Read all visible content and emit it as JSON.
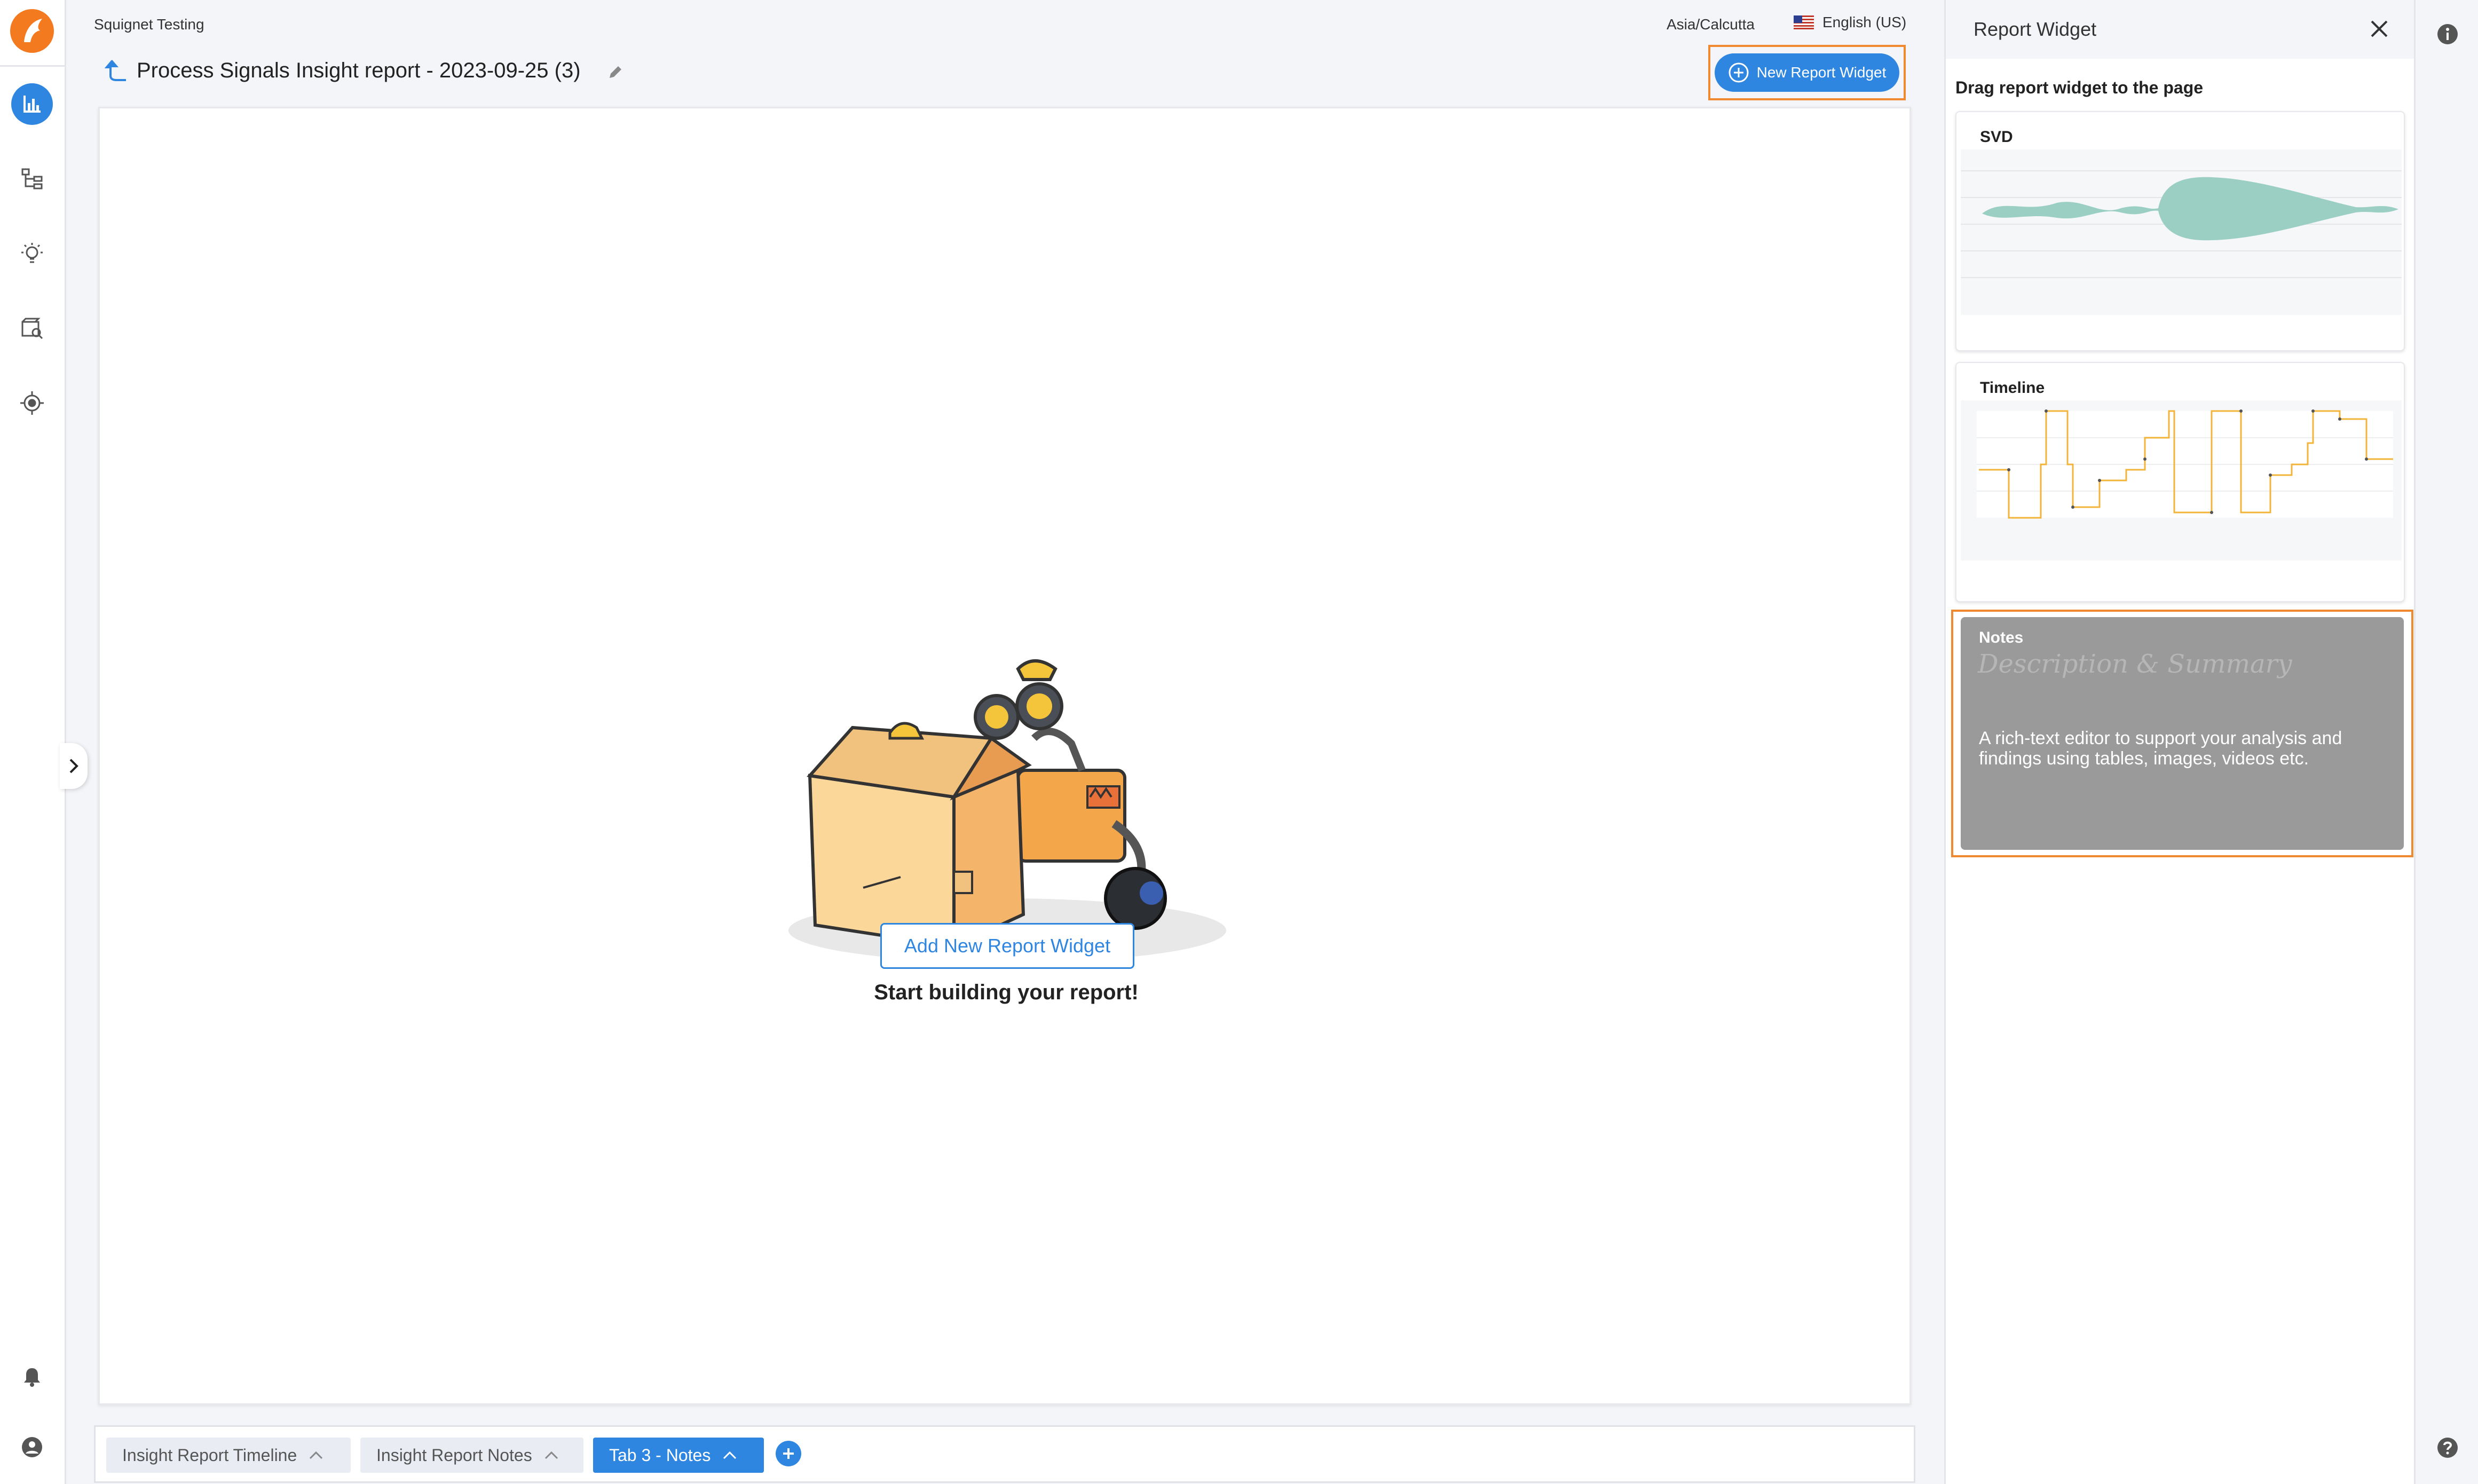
{
  "header": {
    "org_name": "Squignet Testing",
    "timezone": "Asia/Calcutta",
    "language": "English (US)",
    "report_title": "Process Signals Insight report - 2023-09-25 (3)",
    "new_widget_label": "New Report Widget"
  },
  "canvas": {
    "empty_title": "Start building your report!",
    "add_widget_label": "Add New Report Widget"
  },
  "tabs": [
    {
      "label": "Insight Report Timeline",
      "active": false
    },
    {
      "label": "Insight Report Notes",
      "active": false
    },
    {
      "label": "Tab 3 - Notes",
      "active": true
    }
  ],
  "panel": {
    "title": "Report Widget",
    "instruction": "Drag report widget to the page",
    "widgets": [
      {
        "label": "SVD"
      },
      {
        "label": "Timeline"
      },
      {
        "label": "Notes",
        "hint": "Description & Summary",
        "description": "A rich-text editor to support your analysis and findings using tables, images, videos etc.",
        "selected": true
      }
    ]
  },
  "icons": {
    "logo": "app-logo-icon",
    "analytics": "bar-chart-icon",
    "hierarchy": "hierarchy-icon",
    "insights": "lightbulb-icon",
    "media": "media-search-icon",
    "target": "target-icon",
    "notifications": "bell-icon",
    "account": "user-icon",
    "info": "info-icon",
    "help": "help-icon"
  },
  "colors": {
    "accent": "#2f86e0",
    "highlight": "#f08a30",
    "svd_fill": "#9ccfc4",
    "timeline_line": "#f2b53a"
  }
}
